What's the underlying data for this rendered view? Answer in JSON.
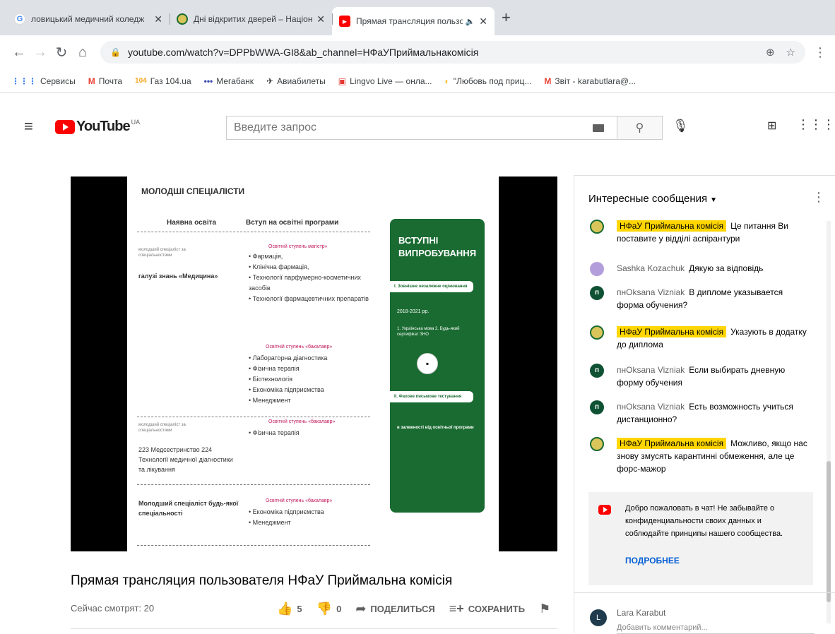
{
  "browser": {
    "tabs": [
      {
        "title": "ловицький медичний коледж",
        "favicon": "google-icon",
        "active": false
      },
      {
        "title": "Дні відкритих дверей – Націона",
        "favicon": "university-crest-icon",
        "active": false
      },
      {
        "title": "Прямая трансляция пользо",
        "favicon": "youtube-icon",
        "active": true
      }
    ],
    "new_tab": "+",
    "url": "youtube.com/watch?v=DPPbWWA-GI8&ab_channel=НФаУПриймальнакомісія",
    "bookmarks": [
      {
        "label": "Сервисы",
        "icon": "apps-grid-icon",
        "color": "#4285f4"
      },
      {
        "label": "Почта",
        "icon": "gmail-icon",
        "color": "#ea4335"
      },
      {
        "label": "Газ 104.ua",
        "icon": "gas-104-icon",
        "color": "#f9a825"
      },
      {
        "label": "Мегабанк",
        "icon": "megabank-icon",
        "color": "#3949ab"
      },
      {
        "label": "Авиабилеты",
        "icon": "plane-icon",
        "color": "#333333"
      },
      {
        "label": "Lingvo Live — онла...",
        "icon": "lingvo-icon",
        "color": "#e53935"
      },
      {
        "label": "\"Любовь под приц...",
        "icon": "bookmark-page-icon",
        "color": "#fbc02d"
      },
      {
        "label": "Звіт - karabutlara@...",
        "icon": "gmail-icon",
        "color": "#ea4335"
      }
    ]
  },
  "youtube": {
    "logo_text": "YouTube",
    "region": "UA",
    "search_placeholder": "Введите запрос"
  },
  "slide": {
    "heading": "МОЛОДШІ СПЕЦІАЛІСТИ",
    "col1_header": "Наявна освіта",
    "col2_header": "Вступ на освітні програми",
    "row1_small": "молодший спеціаліст за спеціальностями",
    "row1_field": "галузі знань «Медицина»",
    "master_label": "Освітній ступень магістр»",
    "master_items": [
      "Фармація,",
      "Клінічна фармація,",
      "Технології парфумерно-косметичних засобів",
      "Технології фармацевтичних препаратів"
    ],
    "bachelor_label": "Освітній ступень «бакалавр»",
    "bachelor_items": [
      "Лабораторна діагностика",
      "Фізична терапія",
      "Біотехнологія",
      "Економіка підприємства",
      "Менеджмент"
    ],
    "row2_small": "молодший спеціаліст за спеціальностями",
    "row2_bachelor_label": "Освітній ступень «бакалавр»",
    "row2_items": [
      "Фізична терапія"
    ],
    "row2_specialties": "223 Медсестринство 224 Технології медичної діагностики та лікування",
    "row3_text": "Молодший спеціаліст будь-якої спеціальності",
    "row3_bachelor_label": "Освітній ступень «бакалавр»",
    "row3_items": [
      "Економіка підприємства",
      "Менеджмент"
    ],
    "card_title": "ВСТУПНІ ВИПРОБУВАННЯ",
    "card_box1": "І. Зовнішнє незалежне оцінювання",
    "card_years": "2018-2021 рр.",
    "card_list": "1. Українська мова 2. Будь-який сертифікат ЗНО",
    "card_box2": "ІІ. Фахове письмове тестування",
    "card_note": "в залежності від освітньої програми"
  },
  "video": {
    "title": "Прямая трансляция пользователя НФаУ Приймальна комісія",
    "viewers": "Сейчас смотрят: 20",
    "likes": "5",
    "dislikes": "0",
    "share_label": "ПОДЕЛИТЬСЯ",
    "save_label": "СОХРАНИТЬ"
  },
  "chat": {
    "header": "Интересные сообщения",
    "messages": [
      {
        "author": "НФаУ Приймальна комісія",
        "owner": true,
        "text": "Це питання Ви поставите у відділі аспірантури",
        "avatar": "crest"
      },
      {
        "author": "Sashka Kozachuk",
        "owner": false,
        "text": "Дякую за відповідь",
        "avatar": "photo"
      },
      {
        "author": "пнOksana Vizniak",
        "owner": false,
        "text": "В дипломе указывается форма обучения?",
        "avatar": "п"
      },
      {
        "author": "НФаУ Приймальна комісія",
        "owner": true,
        "text": "Указують в додатку до диплома",
        "avatar": "crest"
      },
      {
        "author": "пнOksana Vizniak",
        "owner": false,
        "text": "Если выбирать дневную форму обучения",
        "avatar": "п"
      },
      {
        "author": "пнOksana Vizniak",
        "owner": false,
        "text": "Есть возможность учиться дистанционно?",
        "avatar": "п"
      },
      {
        "author": "НФаУ Приймальна комісія",
        "owner": true,
        "text": "Можливо, якщо нас знову змусять карантинні обмеження, але це форс-мажор",
        "avatar": "crest"
      }
    ],
    "welcome_text": "Добро пожаловать в чат! Не забывайте о конфиденциальности своих данных и соблюдайте принципы нашего сообщества.",
    "welcome_more": "ПОДРОБНЕЕ",
    "user_initial": "L",
    "user_name": "Lara Karabut",
    "input_placeholder": "Добавить комментарий..."
  }
}
